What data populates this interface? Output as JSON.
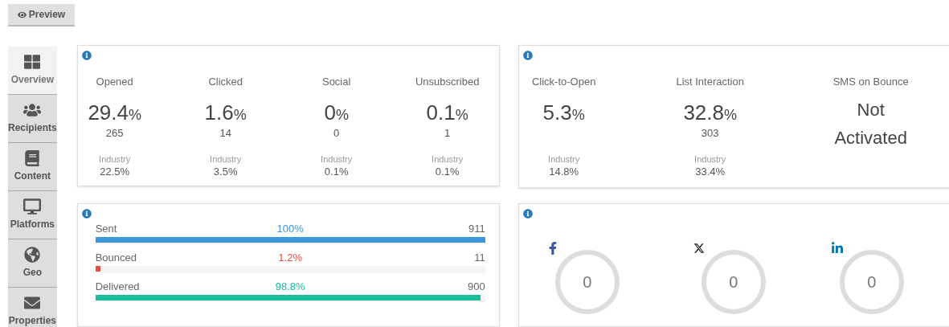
{
  "preview_button": {
    "label": "Preview"
  },
  "sidebar": {
    "items": [
      {
        "label": "Overview",
        "kind": "grid",
        "selected": true
      },
      {
        "label": "Recipients",
        "kind": "users",
        "selected": false
      },
      {
        "label": "Content",
        "kind": "book",
        "selected": false
      },
      {
        "label": "Platforms",
        "kind": "desktop",
        "selected": false
      },
      {
        "label": "Geo",
        "kind": "globe",
        "selected": false
      },
      {
        "label": "Properties",
        "kind": "envelope",
        "selected": false
      }
    ]
  },
  "engagement": {
    "metrics": [
      {
        "kind": "percent",
        "label": "Opened",
        "value": "29.4",
        "unit": "%",
        "count": "265",
        "industry_label": "Industry",
        "industry": "22.5%"
      },
      {
        "kind": "percent",
        "label": "Clicked",
        "value": "1.6",
        "unit": "%",
        "count": "14",
        "industry_label": "Industry",
        "industry": "3.5%"
      },
      {
        "kind": "percent",
        "label": "Social",
        "value": "0",
        "unit": "%",
        "count": "0",
        "industry_label": "Industry",
        "industry": "0.1%"
      },
      {
        "kind": "percent",
        "label": "Unsubscribed",
        "value": "0.1",
        "unit": "%",
        "count": "1",
        "industry_label": "Industry",
        "industry": "0.1%"
      }
    ]
  },
  "interaction": {
    "metrics": [
      {
        "kind": "percent",
        "label": "Click-to-Open",
        "value": "5.3",
        "unit": "%",
        "industry_label": "Industry",
        "industry": "14.8%"
      },
      {
        "kind": "percent",
        "label": "List Interaction",
        "value": "32.8",
        "unit": "%",
        "count": "303",
        "industry_label": "Industry",
        "industry": "33.4%"
      },
      {
        "kind": "status",
        "label": "SMS on Bounce",
        "value": "Not Activated"
      }
    ]
  },
  "delivery": {
    "rows": [
      {
        "label": "Sent",
        "percent": "100%",
        "count": "911",
        "level": 1.0,
        "color": "#3a97d9"
      },
      {
        "label": "Bounced",
        "percent": "1.2%",
        "count": "11",
        "level": 0.012,
        "color": "#e84c3d"
      },
      {
        "label": "Delivered",
        "percent": "98.8%",
        "count": "900",
        "level": 0.988,
        "color": "#1abc9c"
      }
    ]
  },
  "social": {
    "networks": [
      {
        "kind": "facebook",
        "value": "0"
      },
      {
        "kind": "x",
        "value": "0"
      },
      {
        "kind": "linkedin",
        "value": "0"
      }
    ]
  }
}
